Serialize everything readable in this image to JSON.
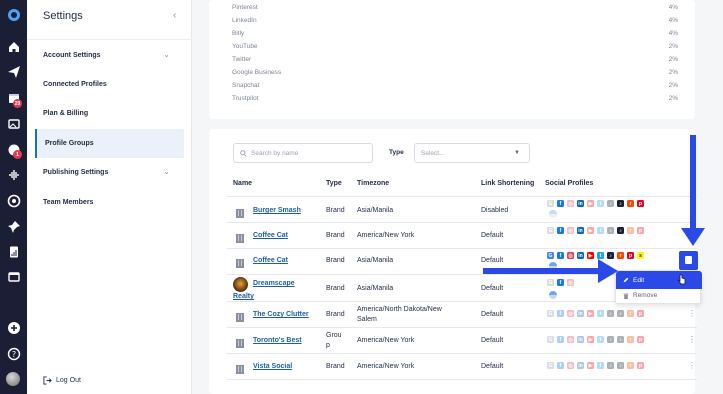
{
  "rail": {
    "badges": {
      "calendar": "29",
      "notifications": "1"
    }
  },
  "sidebar": {
    "title": "Settings",
    "collapse_glyph": "‹",
    "items": [
      {
        "label": "Account Settings",
        "expandable": true,
        "active": false
      },
      {
        "label": "Connected Profiles",
        "expandable": false,
        "active": false
      },
      {
        "label": "Plan & Billing",
        "expandable": false,
        "active": false
      },
      {
        "label": "Profile Groups",
        "expandable": false,
        "active": true
      },
      {
        "label": "Publishing Settings",
        "expandable": true,
        "active": false
      },
      {
        "label": "Team Members",
        "expandable": false,
        "active": false
      }
    ],
    "logout_label": "Log Out"
  },
  "network_breakdown": [
    {
      "name": "Pinterest",
      "pct": "4%"
    },
    {
      "name": "LinkedIn",
      "pct": "4%"
    },
    {
      "name": "Bitly",
      "pct": "4%"
    },
    {
      "name": "YouTube",
      "pct": "2%"
    },
    {
      "name": "Twitter",
      "pct": "2%"
    },
    {
      "name": "Google Business",
      "pct": "2%"
    },
    {
      "name": "Snapchat",
      "pct": "2%"
    },
    {
      "name": "Trustpilot",
      "pct": "2%"
    }
  ],
  "filters": {
    "search_placeholder": "Search by name",
    "type_label": "Type",
    "type_placeholder": "Select..."
  },
  "table": {
    "columns": [
      "Name",
      "Type",
      "Timezone",
      "Link Shortening",
      "Social Profiles"
    ],
    "rows": [
      {
        "name": "Burger Smash",
        "type": "Brand",
        "timezone": "Asia/Manila",
        "link_shortening": "Disabled"
      },
      {
        "name": "Coffee Cat",
        "type": "Brand",
        "timezone": "America/New York",
        "link_shortening": "Default"
      },
      {
        "name": "Coffee Cat",
        "type": "Brand",
        "timezone": "Asia/Manila",
        "link_shortening": "Default"
      },
      {
        "name_line1": "Dreamscape",
        "name_line2": "Realty",
        "type": "Brand",
        "timezone": "Asia/Manila",
        "link_shortening": "Default"
      },
      {
        "name": "The Cozy Clutter",
        "type": "Brand",
        "timezone_line1": "America/North Dakota/New",
        "timezone_line2": "Salem",
        "link_shortening": "Default"
      },
      {
        "name": "Toronto's Best",
        "type_line1": "Grou",
        "type_line2": "p",
        "timezone": "America/New York",
        "link_shortening": "Default"
      },
      {
        "name": "Vista Social",
        "type": "Brand",
        "timezone": "America/New York",
        "link_shortening": "Default"
      }
    ]
  },
  "row_menu": {
    "edit_label": "Edit",
    "remove_label": "Remove"
  },
  "colors": {
    "accent": "#2a49e6",
    "rail_bg": "#1a1f36",
    "link": "#1d5fa8"
  }
}
